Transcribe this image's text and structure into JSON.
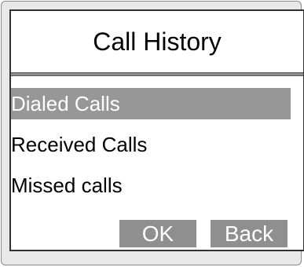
{
  "window": {
    "title": "Call History"
  },
  "menu": {
    "items": [
      {
        "label": "Dialed Calls",
        "selected": true
      },
      {
        "label": "Received Calls",
        "selected": false
      },
      {
        "label": "Missed calls",
        "selected": false
      }
    ]
  },
  "buttons": {
    "ok_label": "OK",
    "back_label": "Back"
  },
  "colors": {
    "selection": "#979797",
    "button": "#8f8f8f",
    "frame": "#e8e8e8"
  }
}
